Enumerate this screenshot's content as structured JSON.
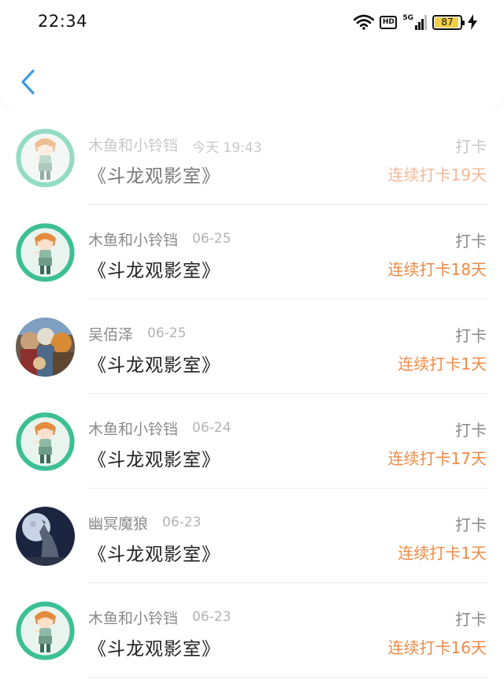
{
  "status_bar": {
    "time": "22:34",
    "hd_label": "HD",
    "network_label": "5G",
    "battery": "87",
    "battery_color": "#f2cf4a"
  },
  "header": {
    "back_icon": "chevron-left-icon",
    "accent": "#3d9ae0"
  },
  "entries": [
    {
      "name": "木鱼和小铃铛",
      "date": "今天 19:43",
      "title": "《斗龙观影室》",
      "action": "打卡",
      "streak": "连续打卡19天",
      "avatar": "anime-girl-avatar"
    },
    {
      "name": "木鱼和小铃铛",
      "date": "06-25",
      "title": "《斗龙观影室》",
      "action": "打卡",
      "streak": "连续打卡18天",
      "avatar": "anime-girl-avatar"
    },
    {
      "name": "吴佰泽",
      "date": "06-25",
      "title": "《斗龙观影室》",
      "action": "打卡",
      "streak": "连续打卡1天",
      "avatar": "group-artwork-avatar"
    },
    {
      "name": "木鱼和小铃铛",
      "date": "06-24",
      "title": "《斗龙观影室》",
      "action": "打卡",
      "streak": "连续打卡17天",
      "avatar": "anime-girl-avatar"
    },
    {
      "name": "幽冥魔狼",
      "date": "06-23",
      "title": "《斗龙观影室》",
      "action": "打卡",
      "streak": "连续打卡1天",
      "avatar": "howling-wolf-avatar"
    },
    {
      "name": "木鱼和小铃铛",
      "date": "06-23",
      "title": "《斗龙观影室》",
      "action": "打卡",
      "streak": "连续打卡16天",
      "avatar": "anime-girl-avatar"
    }
  ],
  "colors": {
    "streak": "#ef8a45",
    "avatar_ring": "#3cbf95"
  }
}
